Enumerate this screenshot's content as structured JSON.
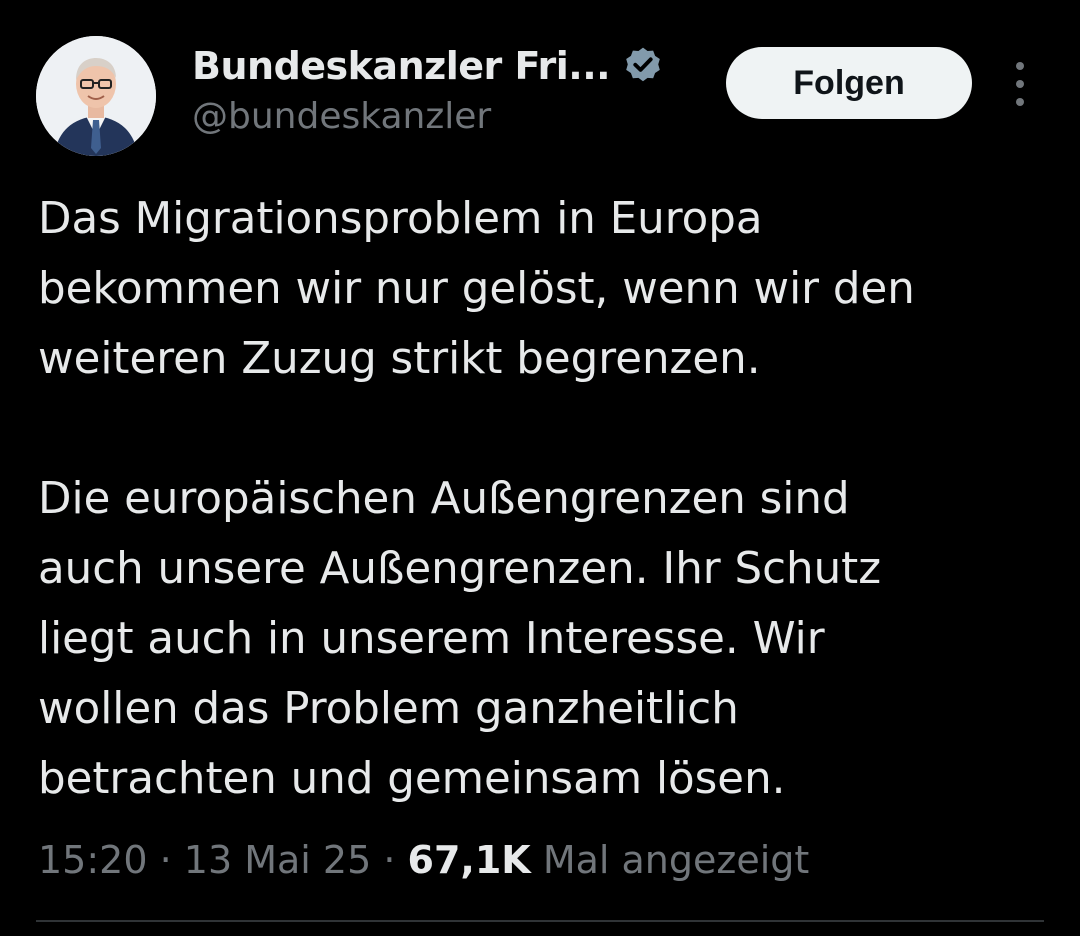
{
  "author": {
    "display_name": "Bundeskanzler Fri...",
    "handle": "@bundeskanzler",
    "avatar_icon": "profile-photo",
    "verified_icon": "verified-badge-icon"
  },
  "actions": {
    "follow_label": "Folgen",
    "more_icon": "more-vertical-icon"
  },
  "tweet": {
    "paragraphs": [
      [
        "Das Migrationsproblem in Europa",
        "bekommen wir nur gelöst, wenn wir den",
        "weiteren Zuzug strikt begrenzen."
      ],
      [
        "Die europäischen Außengrenzen sind",
        "auch unsere Außengrenzen. Ihr Schutz",
        "liegt auch in unserem Interesse. Wir",
        "wollen das Problem ganzheitlich",
        "betrachten und gemeinsam lösen."
      ]
    ]
  },
  "meta": {
    "time": "15:20",
    "separator": " · ",
    "date": "13 Mai 25",
    "views_count": "67,1K",
    "views_label": "Mal angezeigt"
  },
  "colors": {
    "background": "#000000",
    "text_primary": "#e7e9ea",
    "text_secondary": "#71767b",
    "verified": "#829aab",
    "follow_button_bg": "#eff3f4"
  }
}
